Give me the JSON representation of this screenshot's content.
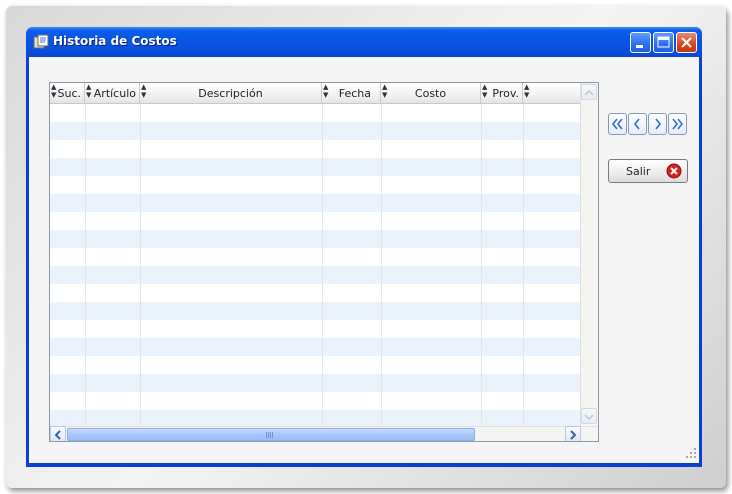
{
  "window": {
    "title": "Historia de Costos",
    "buttons": {
      "minimize": "minimize-icon",
      "maximize": "maximize-icon",
      "close": "close-icon"
    }
  },
  "grid": {
    "columns": [
      {
        "key": "suc",
        "label": "Suc."
      },
      {
        "key": "articulo",
        "label": "Artículo"
      },
      {
        "key": "descripcion",
        "label": "Descripción"
      },
      {
        "key": "fecha",
        "label": "Fecha"
      },
      {
        "key": "costo",
        "label": "Costo"
      },
      {
        "key": "prov",
        "label": "Prov."
      },
      {
        "key": "extra",
        "label": ""
      }
    ],
    "rows": []
  },
  "navigation": {
    "buttons": [
      {
        "name": "first",
        "icon": "double-chevron-left-icon"
      },
      {
        "name": "previous",
        "icon": "chevron-left-icon"
      },
      {
        "name": "next",
        "icon": "chevron-right-icon"
      },
      {
        "name": "last",
        "icon": "double-chevron-right-icon"
      }
    ]
  },
  "actions": {
    "exit_label": "Salir",
    "exit_icon": "error-close-icon"
  },
  "colors": {
    "title_bar": "#0656e4",
    "row_alt": "#eaf2fb",
    "close_icon": "#d42121"
  }
}
